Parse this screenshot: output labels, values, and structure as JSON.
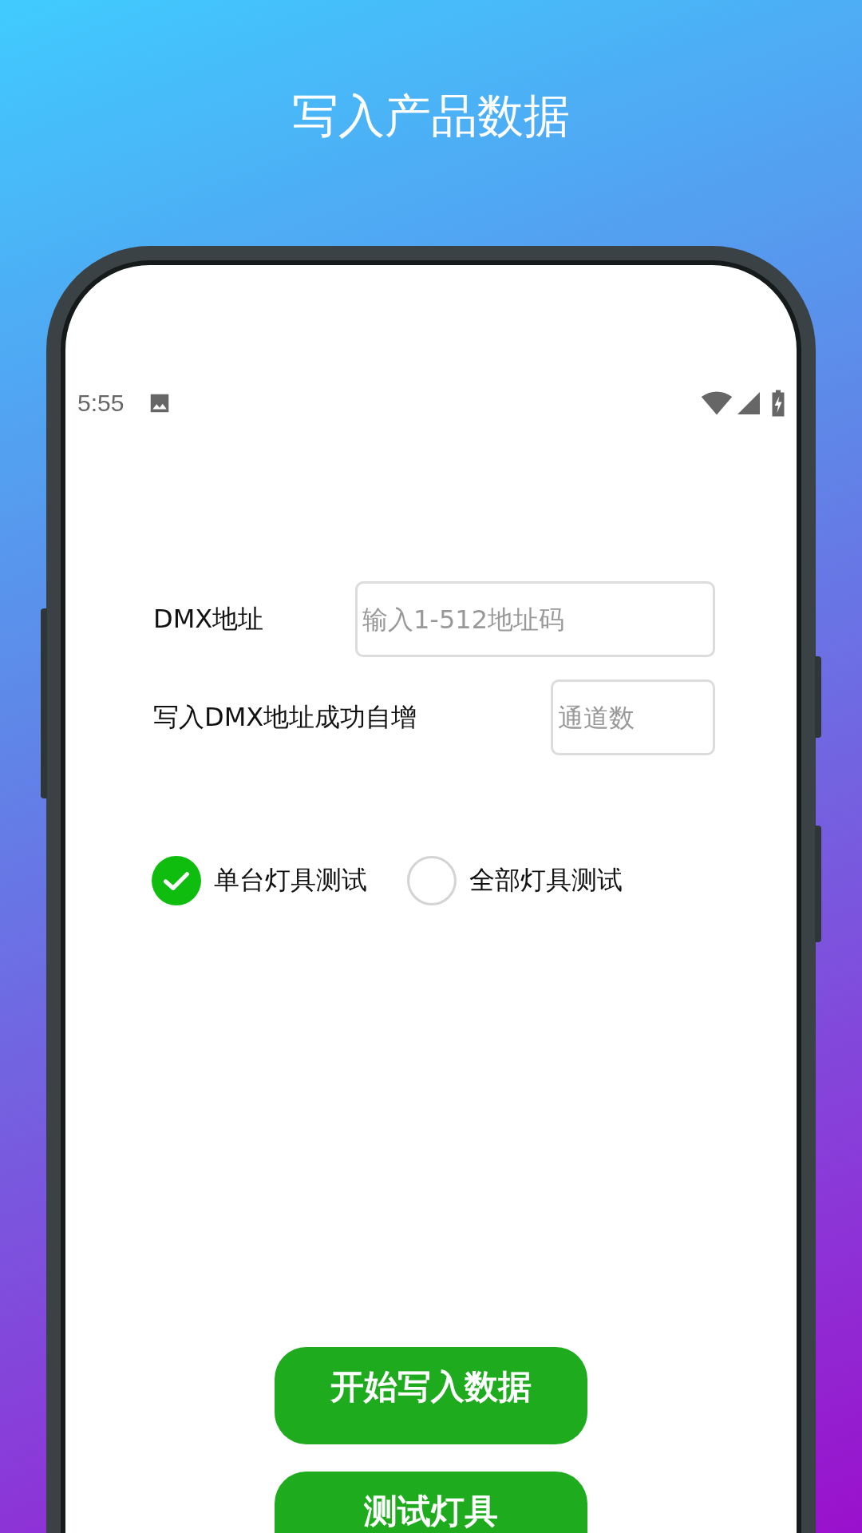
{
  "title": "写入产品数据",
  "status_bar": {
    "time": "5:55"
  },
  "fields": [
    {
      "label": "DMX地址",
      "placeholder": "输入1-512地址码",
      "kind": "wide"
    },
    {
      "label": "写入DMX地址成功自增",
      "placeholder": "通道数",
      "kind": "narrow"
    }
  ],
  "test_mode": [
    {
      "label": "单台灯具测试",
      "selected": true
    },
    {
      "label": "全部灯具测试",
      "selected": false
    }
  ],
  "buttons": [
    "开始写入数据",
    "测试灯具"
  ]
}
